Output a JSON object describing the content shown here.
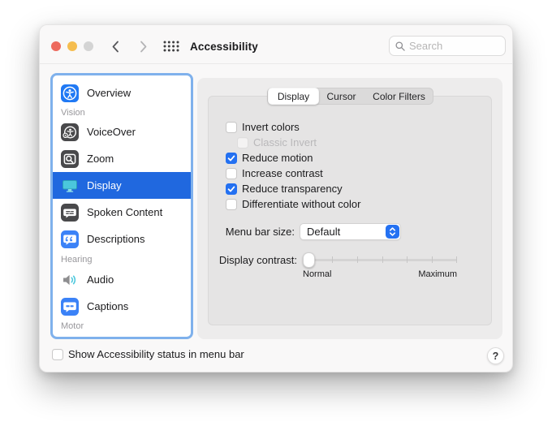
{
  "colors": {
    "accent": "#2471F2",
    "selection": "#2068DF",
    "focus-ring": "#7FB1EC",
    "icon-dark": "#49494B",
    "icon-blue": "#3B82F7",
    "display-teal": "#4BC7DC"
  },
  "header": {
    "title": "Accessibility",
    "search_placeholder": "Search",
    "icons": [
      "traffic-close-icon",
      "traffic-minimize-icon",
      "traffic-zoom-icon",
      "back-chevron-icon",
      "forward-chevron-icon",
      "app-grid-icon",
      "search-icon"
    ]
  },
  "sidebar": {
    "items": [
      {
        "label": "Overview",
        "icon": "accessibility-overview-icon",
        "selected": false
      },
      {
        "header": "Vision"
      },
      {
        "label": "VoiceOver",
        "icon": "voiceover-icon",
        "selected": false
      },
      {
        "label": "Zoom",
        "icon": "zoom-feature-icon",
        "selected": false
      },
      {
        "label": "Display",
        "icon": "display-icon",
        "selected": true
      },
      {
        "label": "Spoken Content",
        "icon": "spoken-content-icon",
        "selected": false
      },
      {
        "label": "Descriptions",
        "icon": "descriptions-icon",
        "selected": false
      },
      {
        "header": "Hearing"
      },
      {
        "label": "Audio",
        "icon": "audio-icon",
        "selected": false
      },
      {
        "label": "Captions",
        "icon": "captions-icon",
        "selected": false
      },
      {
        "header": "Motor"
      }
    ]
  },
  "tabs": {
    "items": [
      {
        "label": "Display",
        "selected": true
      },
      {
        "label": "Cursor",
        "selected": false
      },
      {
        "label": "Color Filters",
        "selected": false
      }
    ]
  },
  "panel": {
    "checkboxes": [
      {
        "label": "Invert colors",
        "checked": false,
        "disabled": false
      },
      {
        "label": "Classic Invert",
        "checked": false,
        "disabled": true
      },
      {
        "label": "Reduce motion",
        "checked": true,
        "disabled": false
      },
      {
        "label": "Increase contrast",
        "checked": false,
        "disabled": false
      },
      {
        "label": "Reduce transparency",
        "checked": true,
        "disabled": false
      },
      {
        "label": "Differentiate without color",
        "checked": false,
        "disabled": false
      }
    ],
    "menu_bar_size": {
      "label": "Menu bar size:",
      "value": "Default"
    },
    "display_contrast": {
      "label": "Display contrast:",
      "min_label": "Normal",
      "max_label": "Maximum",
      "value_position": "minimum"
    }
  },
  "footer": {
    "checkbox_label": "Show Accessibility status in menu bar",
    "checked": false,
    "help_label": "?"
  }
}
